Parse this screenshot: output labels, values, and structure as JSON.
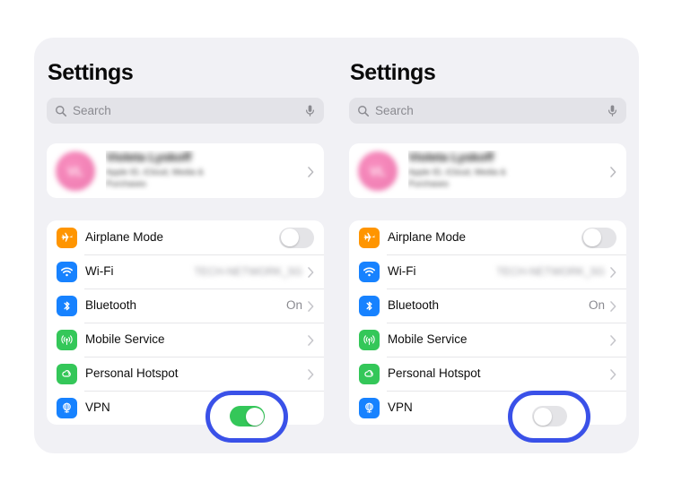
{
  "theme": {
    "page_background": "#ffffff",
    "card_background": "#f1f1f5",
    "row_background": "#ffffff",
    "accent_highlight": "#3a51e8",
    "toggle_on": "#34c759",
    "toggle_off": "#e4e4e7",
    "search_background": "#e3e3e8",
    "secondary_text": "#8a8a90",
    "separator": "#e6e6e9"
  },
  "panels": [
    {
      "id": "panel-vpn-on",
      "title": "Settings",
      "search": {
        "placeholder": "Search",
        "value": "",
        "search_icon": "search-icon",
        "mic_icon": "microphone-icon"
      },
      "profile": {
        "name": "Violeta Lyskoff",
        "subtitle": "Apple ID, iCloud, Media & Purchases",
        "initials": "VL",
        "avatar_color": "#f282b6",
        "chevron": "chevron-right-icon",
        "blurred": true
      },
      "rows": [
        {
          "label": "Airplane Mode",
          "icon": "airplane-icon",
          "icon_color": "#ff9500",
          "control": "toggle",
          "toggle_state": "off",
          "value": "",
          "chevron": false
        },
        {
          "label": "Wi-Fi",
          "icon": "wifi-icon",
          "icon_color": "#1782ff",
          "control": "value",
          "value": "TECH-NETWORK_5G",
          "value_blurred": true,
          "chevron": true
        },
        {
          "label": "Bluetooth",
          "icon": "bluetooth-icon",
          "icon_color": "#1782ff",
          "control": "value",
          "value": "On",
          "value_blurred": false,
          "chevron": true
        },
        {
          "label": "Mobile Service",
          "icon": "cellular-icon",
          "icon_color": "#34c759",
          "control": "value",
          "value": "",
          "chevron": true
        },
        {
          "label": "Personal Hotspot",
          "icon": "hotspot-icon",
          "icon_color": "#34c759",
          "control": "value",
          "value": "",
          "chevron": true
        },
        {
          "label": "VPN",
          "icon": "vpn-globe-icon",
          "icon_color": "#1782ff",
          "control": "toggle",
          "toggle_state": "on",
          "value": "",
          "chevron": false,
          "highlighted": true
        }
      ]
    },
    {
      "id": "panel-vpn-off",
      "title": "Settings",
      "search": {
        "placeholder": "Search",
        "value": "",
        "search_icon": "search-icon",
        "mic_icon": "microphone-icon"
      },
      "profile": {
        "name": "Violeta Lyskoff",
        "subtitle": "Apple ID, iCloud, Media & Purchases",
        "initials": "VL",
        "avatar_color": "#f282b6",
        "chevron": "chevron-right-icon",
        "blurred": true
      },
      "rows": [
        {
          "label": "Airplane Mode",
          "icon": "airplane-icon",
          "icon_color": "#ff9500",
          "control": "toggle",
          "toggle_state": "off",
          "value": "",
          "chevron": false
        },
        {
          "label": "Wi-Fi",
          "icon": "wifi-icon",
          "icon_color": "#1782ff",
          "control": "value",
          "value": "TECH-NETWORK_5G",
          "value_blurred": true,
          "chevron": true
        },
        {
          "label": "Bluetooth",
          "icon": "bluetooth-icon",
          "icon_color": "#1782ff",
          "control": "value",
          "value": "On",
          "value_blurred": false,
          "chevron": true
        },
        {
          "label": "Mobile Service",
          "icon": "cellular-icon",
          "icon_color": "#34c759",
          "control": "value",
          "value": "",
          "chevron": true
        },
        {
          "label": "Personal Hotspot",
          "icon": "hotspot-icon",
          "icon_color": "#34c759",
          "control": "value",
          "value": "",
          "chevron": true
        },
        {
          "label": "VPN",
          "icon": "vpn-globe-icon",
          "icon_color": "#1782ff",
          "control": "toggle",
          "toggle_state": "off",
          "value": "",
          "chevron": false,
          "highlighted": true
        }
      ]
    }
  ]
}
